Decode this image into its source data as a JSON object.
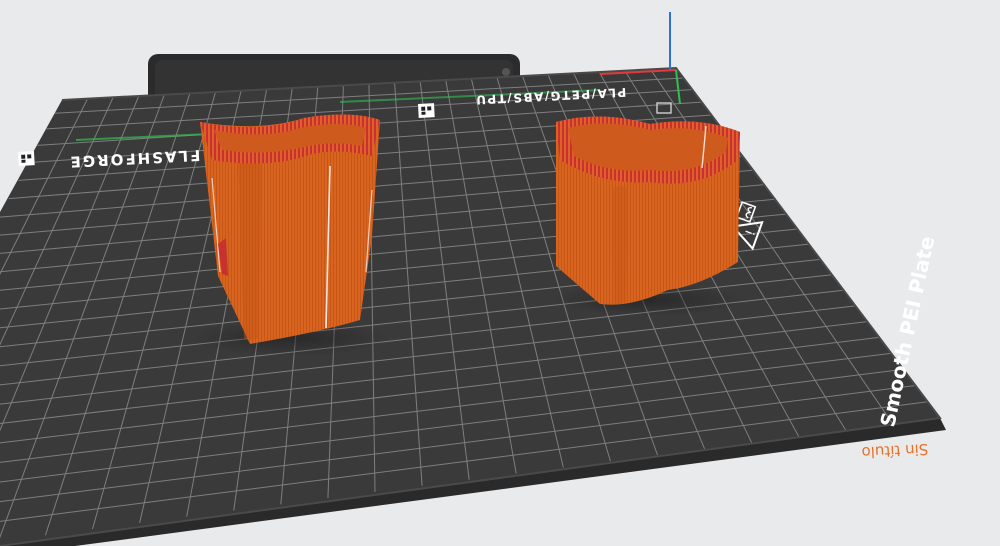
{
  "plate": {
    "brand_text": "FLASHFORGE",
    "material_text": "PLA/PETG/ABS/TPU",
    "plate_name": "Smooth PEI Plate",
    "project_name": "Sin título"
  },
  "colors": {
    "plate": "#3a3a3a",
    "grid": "#8b8b8b",
    "model": "#d9641f",
    "model_top": "#c8322e",
    "axis_x": "#e23a3a",
    "axis_y": "#2fbf52",
    "axis_z": "#2f6fe0",
    "label": "#e8712a"
  },
  "icons": [
    "qr-marker-icon",
    "warning-icon",
    "hot-surface-icon"
  ]
}
